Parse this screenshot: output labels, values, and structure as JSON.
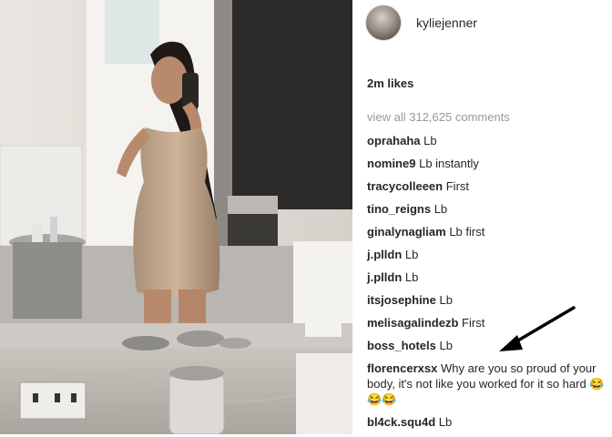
{
  "post": {
    "username": "kyliejenner",
    "likes": "2m likes",
    "view_all": "view all 312,625 comments",
    "comments": [
      {
        "user": "oprahaha",
        "text": "Lb"
      },
      {
        "user": "nomine9",
        "text": "Lb instantly"
      },
      {
        "user": "tracycolleeen",
        "text": "First"
      },
      {
        "user": "tino_reigns",
        "text": "Lb"
      },
      {
        "user": "ginalynagliam",
        "text": "Lb first"
      },
      {
        "user": "j.plldn",
        "text": "Lb"
      },
      {
        "user": "j.plldn",
        "text": "Lb"
      },
      {
        "user": "itsjosephine",
        "text": "Lb"
      },
      {
        "user": "melisagalindezb",
        "text": "First"
      },
      {
        "user": "boss_hotels",
        "text": "Lb"
      },
      {
        "user": "florencerxsx",
        "text": "Why are you so proud of your body, it's not like you worked for it so hard 😂😂😂"
      },
      {
        "user": "bl4ck.squ4d",
        "text": "Lb"
      }
    ]
  },
  "icons": {
    "annotation_arrow": "arrow-icon"
  },
  "colors": {
    "username": "#262626",
    "muted": "#999999",
    "arrow": "#000000"
  }
}
